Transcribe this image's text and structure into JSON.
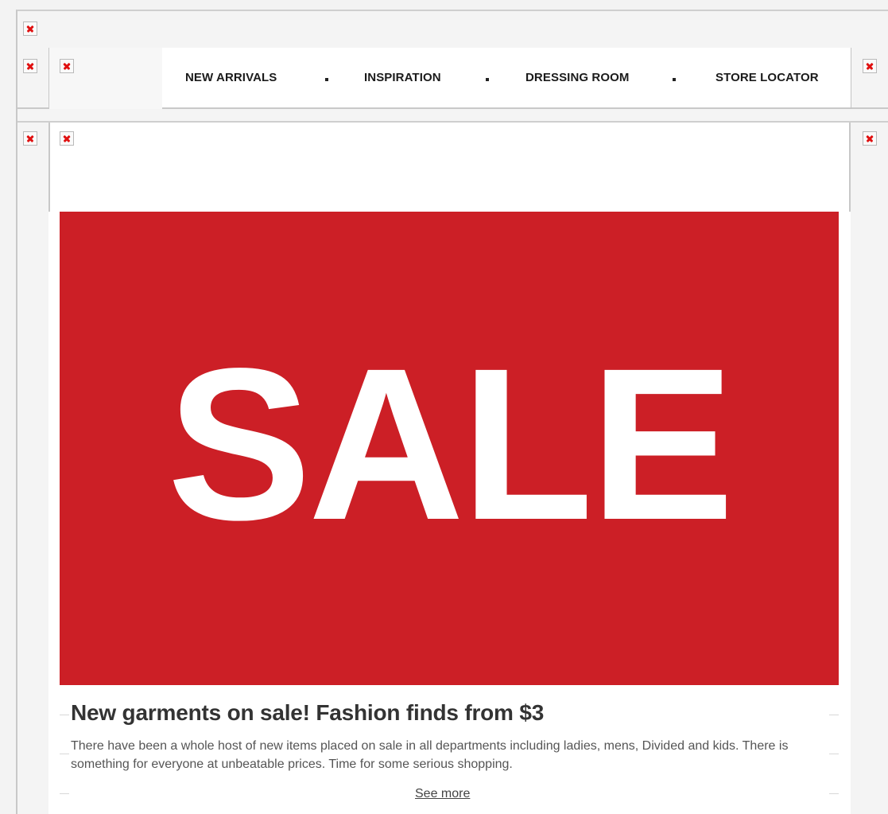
{
  "nav": {
    "items": [
      {
        "label": "NEW ARRIVALS"
      },
      {
        "label": "INSPIRATION"
      },
      {
        "label": "DRESSING ROOM"
      },
      {
        "label": "STORE LOCATOR"
      }
    ],
    "separator": "•"
  },
  "banner": {
    "text": "SALE",
    "background": "#cc1f26",
    "text_color": "#ffffff"
  },
  "promo": {
    "headline": "New garments on sale! Fashion finds from $3",
    "body": "There have been a whole host of new items placed on sale in all departments including ladies, mens, Divided and kids. There is something for everyone at unbeatable prices. Time for some serious shopping.",
    "link": "See more"
  },
  "icons": {
    "broken_image": "broken-image-icon"
  }
}
